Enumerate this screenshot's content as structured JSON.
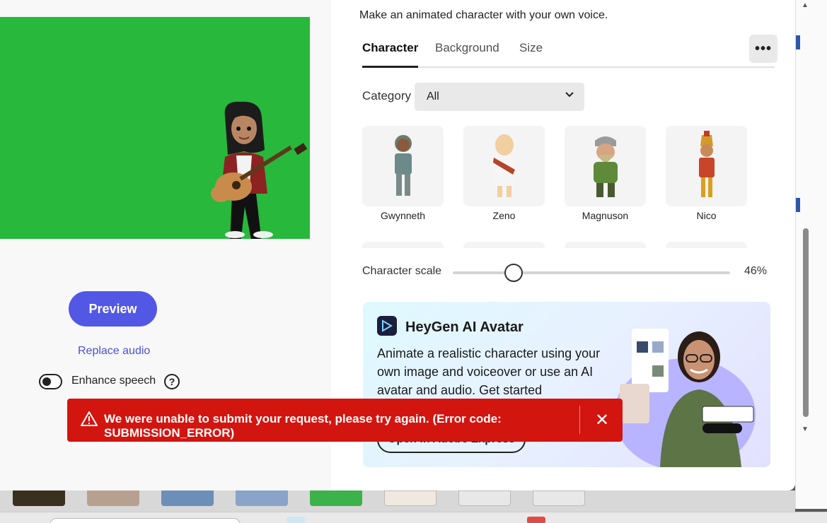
{
  "header": {
    "subtitle": "Make an animated character with your own voice."
  },
  "tabs": [
    {
      "label": "Character",
      "active": true
    },
    {
      "label": "Background",
      "active": false
    },
    {
      "label": "Size",
      "active": false
    }
  ],
  "more_icon": "more-horizontal-icon",
  "category": {
    "label": "Category",
    "selected": "All"
  },
  "characters": [
    {
      "name": "Gwynneth"
    },
    {
      "name": "Zeno"
    },
    {
      "name": "Magnuson"
    },
    {
      "name": "Nico"
    }
  ],
  "character_scale": {
    "label": "Character scale",
    "value_text": "46%",
    "value": 0.46
  },
  "left": {
    "preview_label": "Preview",
    "replace_audio_label": "Replace audio",
    "enhance_speech_label": "Enhance speech",
    "enhance_speech_on": false,
    "help_glyph": "?"
  },
  "promo": {
    "title": "HeyGen AI Avatar",
    "body": "Animate a realistic character using your own image and voiceover or use an AI avatar and audio. Get started",
    "button_label": "Open in Adobe Express"
  },
  "error_toast": {
    "message": "We were unable to submit your request, please try again. (Error code: SUBMISSION_ERROR)",
    "close_glyph": "✕"
  },
  "colors": {
    "accent": "#5258e4",
    "error": "#d31510",
    "green_screen": "#27b83c"
  }
}
